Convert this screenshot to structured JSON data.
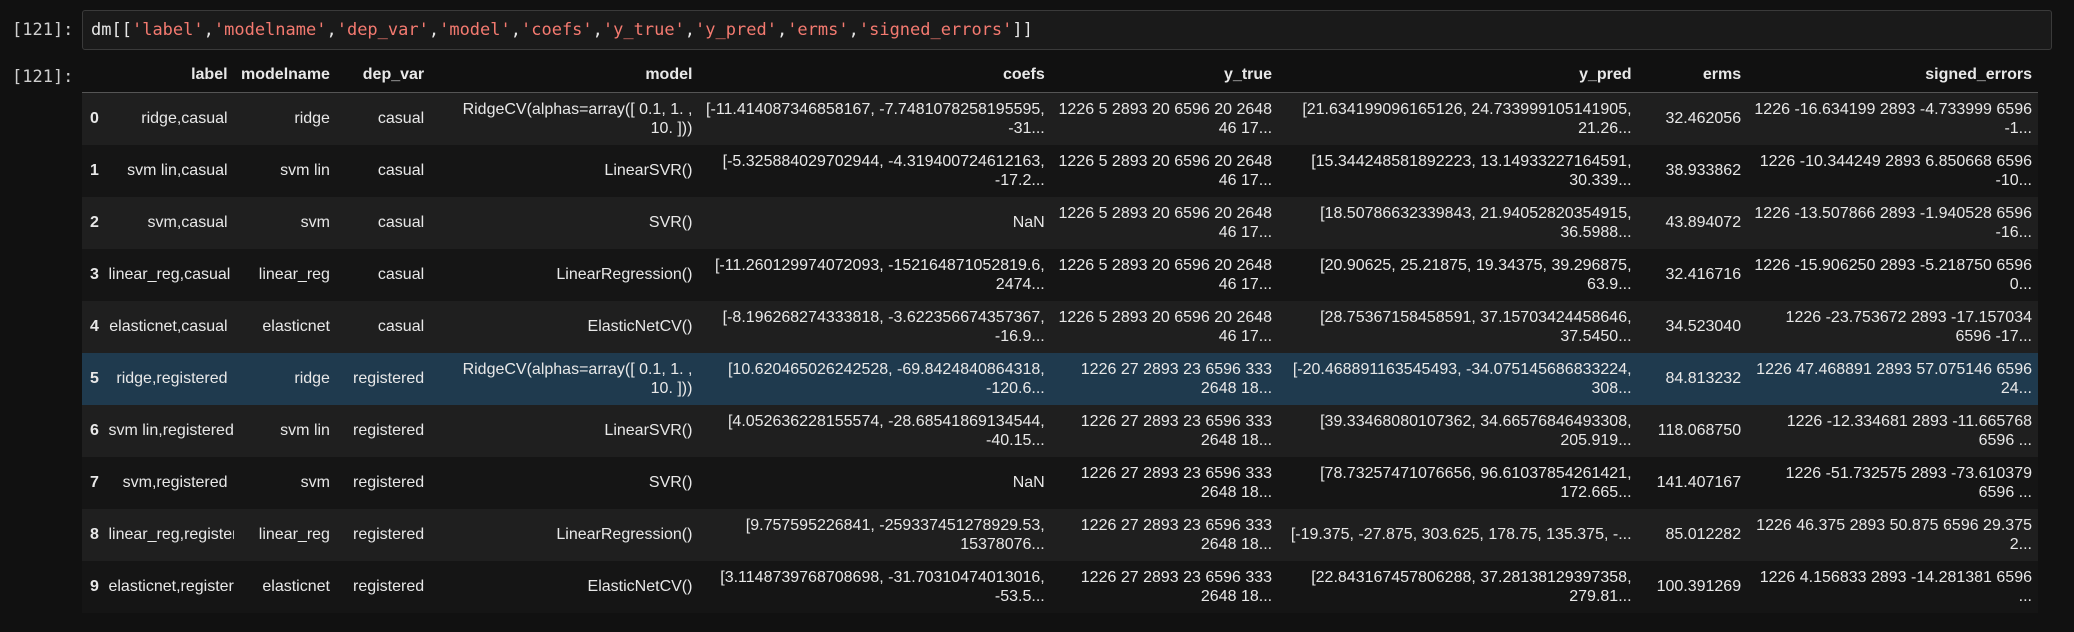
{
  "cell": {
    "input_prompt": "[121]:",
    "output_prompt": "[121]:",
    "code_var": "dm",
    "code_columns": [
      "'label'",
      "'modelname'",
      "'dep_var'",
      "'model'",
      "'coefs'",
      "'y_true'",
      "'y_pred'",
      "'erms'",
      "'signed_errors'"
    ]
  },
  "table": {
    "index_header": "",
    "columns": [
      "label",
      "modelname",
      "dep_var",
      "model",
      "coefs",
      "y_true",
      "y_pred",
      "erms",
      "signed_errors"
    ],
    "selected_row": 5,
    "rows": [
      {
        "index": "0",
        "label": "ridge,casual",
        "modelname": "ridge",
        "dep_var": "casual",
        "model": "RidgeCV(alphas=array([ 0.1, 1. , 10. ]))",
        "coefs": "[-11.414087346858167, -7.7481078258195595, -31...",
        "y_true": "1226 5 2893 20 6596 20 2648 46 17...",
        "y_pred": "[21.634199096165126, 24.733999105141905, 21.26...",
        "erms": "32.462056",
        "signed_errors": "1226 -16.634199 2893 -4.733999 6596 -1..."
      },
      {
        "index": "1",
        "label": "svm lin,casual",
        "modelname": "svm lin",
        "dep_var": "casual",
        "model": "LinearSVR()",
        "coefs": "[-5.325884029702944, -4.319400724612163, -17.2...",
        "y_true": "1226 5 2893 20 6596 20 2648 46 17...",
        "y_pred": "[15.344248581892223, 13.14933227164591, 30.339...",
        "erms": "38.933862",
        "signed_errors": "1226 -10.344249 2893 6.850668 6596 -10..."
      },
      {
        "index": "2",
        "label": "svm,casual",
        "modelname": "svm",
        "dep_var": "casual",
        "model": "SVR()",
        "coefs": "NaN",
        "y_true": "1226 5 2893 20 6596 20 2648 46 17...",
        "y_pred": "[18.50786632339843, 21.94052820354915, 36.5988...",
        "erms": "43.894072",
        "signed_errors": "1226 -13.507866 2893 -1.940528 6596 -16..."
      },
      {
        "index": "3",
        "label": "linear_reg,casual",
        "modelname": "linear_reg",
        "dep_var": "casual",
        "model": "LinearRegression()",
        "coefs": "[-11.260129974072093, -152164871052819.6, 2474...",
        "y_true": "1226 5 2893 20 6596 20 2648 46 17...",
        "y_pred": "[20.90625, 25.21875, 19.34375, 39.296875, 63.9...",
        "erms": "32.416716",
        "signed_errors": "1226 -15.906250 2893 -5.218750 6596 0..."
      },
      {
        "index": "4",
        "label": "elasticnet,casual",
        "modelname": "elasticnet",
        "dep_var": "casual",
        "model": "ElasticNetCV()",
        "coefs": "[-8.196268274333818, -3.622356674357367, -16.9...",
        "y_true": "1226 5 2893 20 6596 20 2648 46 17...",
        "y_pred": "[28.75367158458591, 37.15703424458646, 37.5450...",
        "erms": "34.523040",
        "signed_errors": "1226 -23.753672 2893 -17.157034 6596 -17..."
      },
      {
        "index": "5",
        "label": "ridge,registered",
        "modelname": "ridge",
        "dep_var": "registered",
        "model": "RidgeCV(alphas=array([ 0.1, 1. , 10. ]))",
        "coefs": "[10.620465026242528, -69.8424840864318, -120.6...",
        "y_true": "1226 27 2893 23 6596 333 2648 18...",
        "y_pred": "[-20.468891163545493, -34.075145686833224, 308...",
        "erms": "84.813232",
        "signed_errors": "1226 47.468891 2893 57.075146 6596 24..."
      },
      {
        "index": "6",
        "label": "svm lin,registered",
        "modelname": "svm lin",
        "dep_var": "registered",
        "model": "LinearSVR()",
        "coefs": "[4.052636228155574, -28.68541869134544, -40.15...",
        "y_true": "1226 27 2893 23 6596 333 2648 18...",
        "y_pred": "[39.33468080107362, 34.66576846493308, 205.919...",
        "erms": "118.068750",
        "signed_errors": "1226 -12.334681 2893 -11.665768 6596 ..."
      },
      {
        "index": "7",
        "label": "svm,registered",
        "modelname": "svm",
        "dep_var": "registered",
        "model": "SVR()",
        "coefs": "NaN",
        "y_true": "1226 27 2893 23 6596 333 2648 18...",
        "y_pred": "[78.73257471076656, 96.61037854261421, 172.665...",
        "erms": "141.407167",
        "signed_errors": "1226 -51.732575 2893 -73.610379 6596 ..."
      },
      {
        "index": "8",
        "label": "linear_reg,registered",
        "modelname": "linear_reg",
        "dep_var": "registered",
        "model": "LinearRegression()",
        "coefs": "[9.757595226841, -259337451278929.53, 15378076...",
        "y_true": "1226 27 2893 23 6596 333 2648 18...",
        "y_pred": "[-19.375, -27.875, 303.625, 178.75, 135.375, -...",
        "erms": "85.012282",
        "signed_errors": "1226 46.375 2893 50.875 6596 29.375 2..."
      },
      {
        "index": "9",
        "label": "elasticnet,registered",
        "modelname": "elasticnet",
        "dep_var": "registered",
        "model": "ElasticNetCV()",
        "coefs": "[3.1148739768708698, -31.70310474013016, -53.5...",
        "y_true": "1226 27 2893 23 6596 333 2648 18...",
        "y_pred": "[22.843167457806288, 37.28138129397358, 279.81...",
        "erms": "100.391269",
        "signed_errors": "1226 4.156833 2893 -14.281381 6596 ..."
      }
    ]
  }
}
